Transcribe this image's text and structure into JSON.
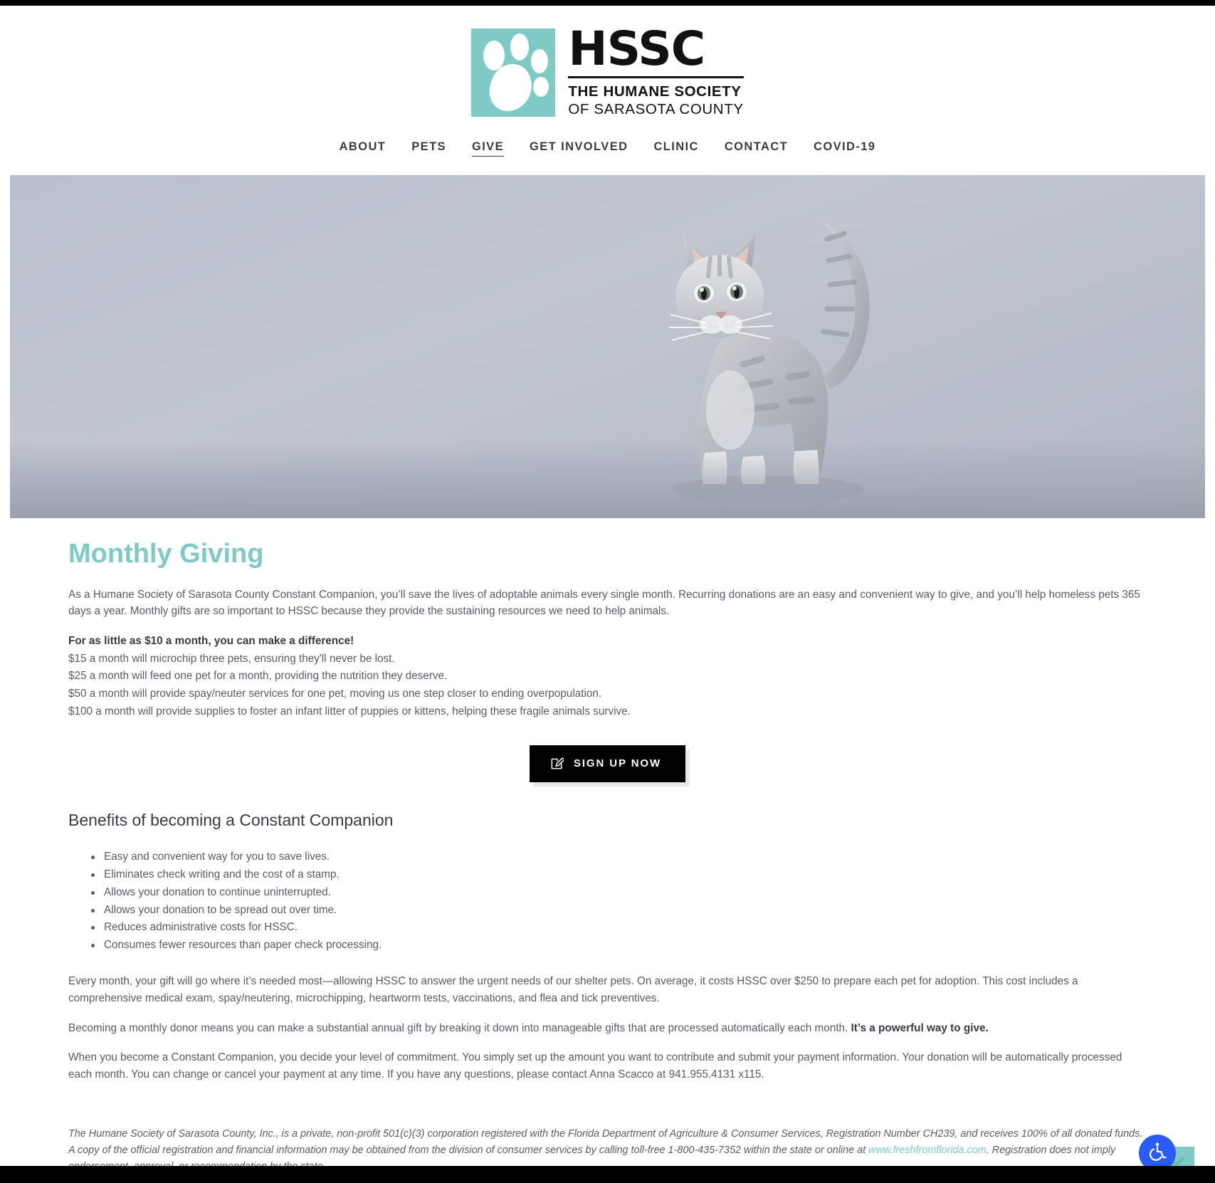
{
  "site": {
    "logo": {
      "mark_alt": "paw-print",
      "brand": "HSSC",
      "sub_line1": "THE HUMANE SOCIETY",
      "sub_line2": "OF SARASOTA COUNTY",
      "accent_color": "#7ecbc6"
    },
    "nav": {
      "items": [
        {
          "label": "ABOUT",
          "active": false
        },
        {
          "label": "PETS",
          "active": false
        },
        {
          "label": "GIVE",
          "active": true
        },
        {
          "label": "GET INVOLVED",
          "active": false
        },
        {
          "label": "CLINIC",
          "active": false
        },
        {
          "label": "CONTACT",
          "active": false
        },
        {
          "label": "COVID-19",
          "active": false
        }
      ]
    }
  },
  "hero": {
    "image_alt": "grey tabby kitten standing on grey studio backdrop"
  },
  "main": {
    "title": "Monthly Giving",
    "intro": "As a Humane Society of Sarasota County Constant Companion, you’ll save the lives of adoptable animals every single month. Recurring donations are an easy and convenient way to give, and you’ll help homeless pets 365 days a year. Monthly gifts are so important to HSSC because they provide the sustaining resources we need to help animals.",
    "tiers_heading": "For as little as $10 a month, you can make a difference!",
    "tiers": [
      "$15 a month will microchip three pets, ensuring they'll never be lost.",
      "$25 a month will feed one pet for a month, providing the nutrition they deserve.",
      "$50 a month will provide spay/neuter services for one pet, moving us one step closer to ending overpopulation.",
      "$100 a month will provide supplies to foster an infant litter of puppies or kittens, helping these fragile animals survive."
    ],
    "cta": {
      "label": "SIGN UP NOW",
      "icon": "edit-square-icon",
      "background": "#010101"
    },
    "benefits_heading": "Benefits of becoming a Constant Companion",
    "benefits": [
      "Easy and convenient way for you to save lives.",
      "Eliminates check writing and the cost of a stamp.",
      "Allows your donation to continue uninterrupted.",
      "Allows your donation to be spread out over time.",
      "Reduces administrative costs for HSSC.",
      "Consumes fewer resources than paper check processing."
    ],
    "para_cost": "Every month, your gift will go where it’s needed most—allowing HSSC to answer the urgent needs of our shelter pets. On average, it costs HSSC over $250 to prepare each pet for adoption. This cost includes a comprehensive medical exam, spay/neutering, microchipping, heartworm tests, vaccinations, and flea and tick preventives.",
    "para_annual_lead": "Becoming a monthly donor means you can make a substantial annual gift by breaking it down into manageable gifts that are processed automatically each month. ",
    "para_annual_bold": "It’s a powerful way to give.",
    "para_commitment": "When you become a Constant Companion, you decide your level of commitment. You simply set up the amount you want to contribute and submit your payment information. Your donation will be automatically processed each month. You can change or cancel your payment at any time. If you have any questions, please contact Anna Scacco at 941.955.4131 x115."
  },
  "footer": {
    "disclaimer_part1": "The Humane Society of Sarasota County, Inc., is a private, non-profit 501(c)(3) corporation registered with the Florida Department of Agriculture & Consumer Services, Registration Number CH239, and receives 100% of all donated funds. A copy of the official registration and financial information may be obtained from the division of consumer services by calling toll-free 1-800-435-7352 within the state or online at ",
    "disclaimer_link": "www.freshfromflorida.com",
    "disclaimer_part2": ". Registration does not imply endorsement, approval, or recommendation by the state."
  },
  "widgets": {
    "accessibility": {
      "icon": "wheelchair-accessibility-icon",
      "color": "#2a5bf5"
    },
    "chat": {
      "icon": "chevron-down-icon",
      "color": "#7ecbc6"
    }
  }
}
